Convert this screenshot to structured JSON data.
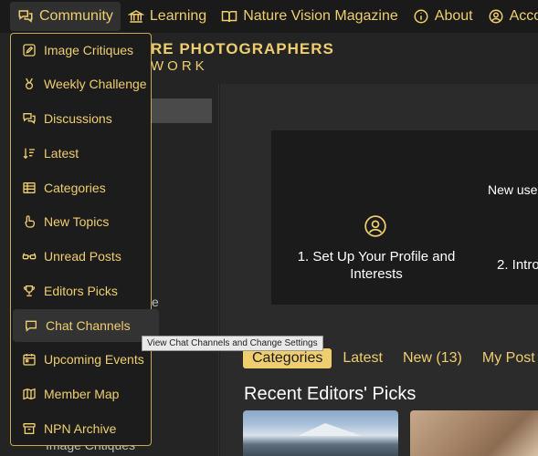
{
  "nav": {
    "items": [
      {
        "label": "Community",
        "icon": "chat-bubbles-icon"
      },
      {
        "label": "Learning",
        "icon": "institution-icon"
      },
      {
        "label": "Nature Vision Magazine",
        "icon": "open-book-icon"
      },
      {
        "label": "About",
        "icon": "info-icon"
      },
      {
        "label": "Accoun",
        "icon": "user-circle-icon"
      }
    ]
  },
  "brand": {
    "line1": "RE PHOTOGRAPHERS",
    "line2": "WORK"
  },
  "sidebar": {
    "partial_text": "e",
    "bottom_text": "Image Critiques"
  },
  "dropdown": {
    "items": [
      {
        "label": "Image Critiques",
        "icon": "edit-square-icon"
      },
      {
        "label": "Weekly Challenge",
        "icon": "medal-icon"
      },
      {
        "label": "Discussions",
        "icon": "chat-bubbles-icon"
      },
      {
        "label": "Latest",
        "icon": "sort-list-icon"
      },
      {
        "label": "Categories",
        "icon": "table-icon"
      },
      {
        "label": "New Topics",
        "icon": "hand-point-icon"
      },
      {
        "label": "Unread Posts",
        "icon": "glasses-icon"
      },
      {
        "label": "Editors Picks",
        "icon": "trophy-icon"
      },
      {
        "label": "Chat Channels",
        "icon": "chat-bubble-icon"
      },
      {
        "label": "Upcoming Events",
        "icon": "calendar-icon"
      },
      {
        "label": "Member Map",
        "icon": "map-icon"
      },
      {
        "label": "NPN Archive",
        "icon": "archive-icon"
      }
    ]
  },
  "tooltip": "View Chat Channels and Change Settings",
  "banner": {
    "new_user": "New user",
    "step1": "1. Set Up Your Profile and Interests",
    "step2": "2. Intro"
  },
  "tabs": [
    "Categories",
    "Latest",
    "New (13)",
    "My Post"
  ],
  "recent_title": "Recent Editors' Picks",
  "colors": {
    "accent": "#efce6f",
    "background": "#1f1f1f",
    "panel": "#1c1c1c"
  }
}
